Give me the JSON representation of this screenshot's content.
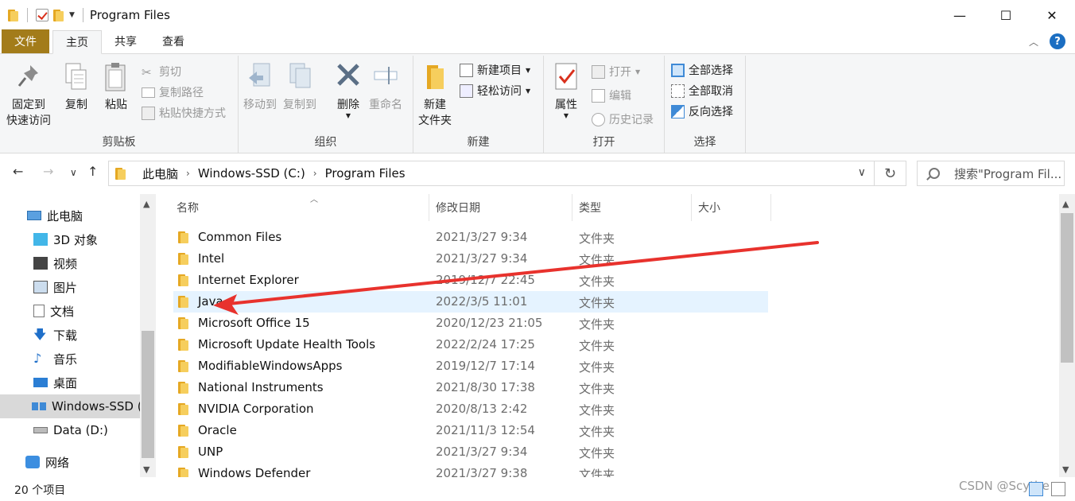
{
  "window": {
    "title": "Program Files",
    "minimize": "—",
    "maximize": "☐",
    "close": "✕"
  },
  "tabs": [
    "文件",
    "主页",
    "共享",
    "查看"
  ],
  "ribbon": {
    "clipboard": {
      "label": "剪贴板",
      "pin_line1": "固定到",
      "pin_line2": "快速访问",
      "copy": "复制",
      "paste": "粘贴",
      "cut": "剪切",
      "copy_path": "复制路径",
      "paste_shortcut": "粘贴快捷方式"
    },
    "organize": {
      "label": "组织",
      "move_to": "移动到",
      "copy_to": "复制到",
      "delete": "删除",
      "rename": "重命名"
    },
    "new": {
      "label": "新建",
      "new_folder_line1": "新建",
      "new_folder_line2": "文件夹",
      "new_item": "新建项目",
      "easy_access": "轻松访问"
    },
    "open": {
      "label": "打开",
      "properties": "属性",
      "open": "打开",
      "edit": "编辑",
      "history": "历史记录"
    },
    "select": {
      "label": "选择",
      "select_all": "全部选择",
      "select_none": "全部取消",
      "invert": "反向选择"
    }
  },
  "address": {
    "crumbs": [
      "此电脑",
      "Windows-SSD (C:)",
      "Program Files"
    ],
    "search_placeholder": "搜索\"Program Fil..."
  },
  "nav_pane": {
    "items": [
      "此电脑",
      "3D 对象",
      "视频",
      "图片",
      "文档",
      "下载",
      "音乐",
      "桌面",
      "Windows-SSD (",
      "Data (D:)",
      "网络"
    ]
  },
  "columns": [
    "名称",
    "修改日期",
    "类型",
    "大小"
  ],
  "files": [
    {
      "name": "Common Files",
      "date": "2021/3/27 9:34",
      "type": "文件夹"
    },
    {
      "name": "Intel",
      "date": "2021/3/27 9:34",
      "type": "文件夹"
    },
    {
      "name": "Internet Explorer",
      "date": "2019/12/7 22:45",
      "type": "文件夹"
    },
    {
      "name": "Java",
      "date": "2022/3/5 11:01",
      "type": "文件夹"
    },
    {
      "name": "Microsoft Office 15",
      "date": "2020/12/23 21:05",
      "type": "文件夹"
    },
    {
      "name": "Microsoft Update Health Tools",
      "date": "2022/2/24 17:25",
      "type": "文件夹"
    },
    {
      "name": "ModifiableWindowsApps",
      "date": "2019/12/7 17:14",
      "type": "文件夹"
    },
    {
      "name": "National Instruments",
      "date": "2021/8/30 17:38",
      "type": "文件夹"
    },
    {
      "name": "NVIDIA Corporation",
      "date": "2020/8/13 2:42",
      "type": "文件夹"
    },
    {
      "name": "Oracle",
      "date": "2021/11/3 12:54",
      "type": "文件夹"
    },
    {
      "name": "UNP",
      "date": "2021/3/27 9:34",
      "type": "文件夹"
    },
    {
      "name": "Windows Defender",
      "date": "2021/3/27 9:38",
      "type": "文件夹"
    }
  ],
  "status": {
    "count": "20 个项目",
    "watermark": "CSDN @Scythe"
  },
  "colors": {
    "file_tab": "#a37c1a",
    "selected_row": "#e5f3ff",
    "annotation_arrow": "#e8322d"
  }
}
